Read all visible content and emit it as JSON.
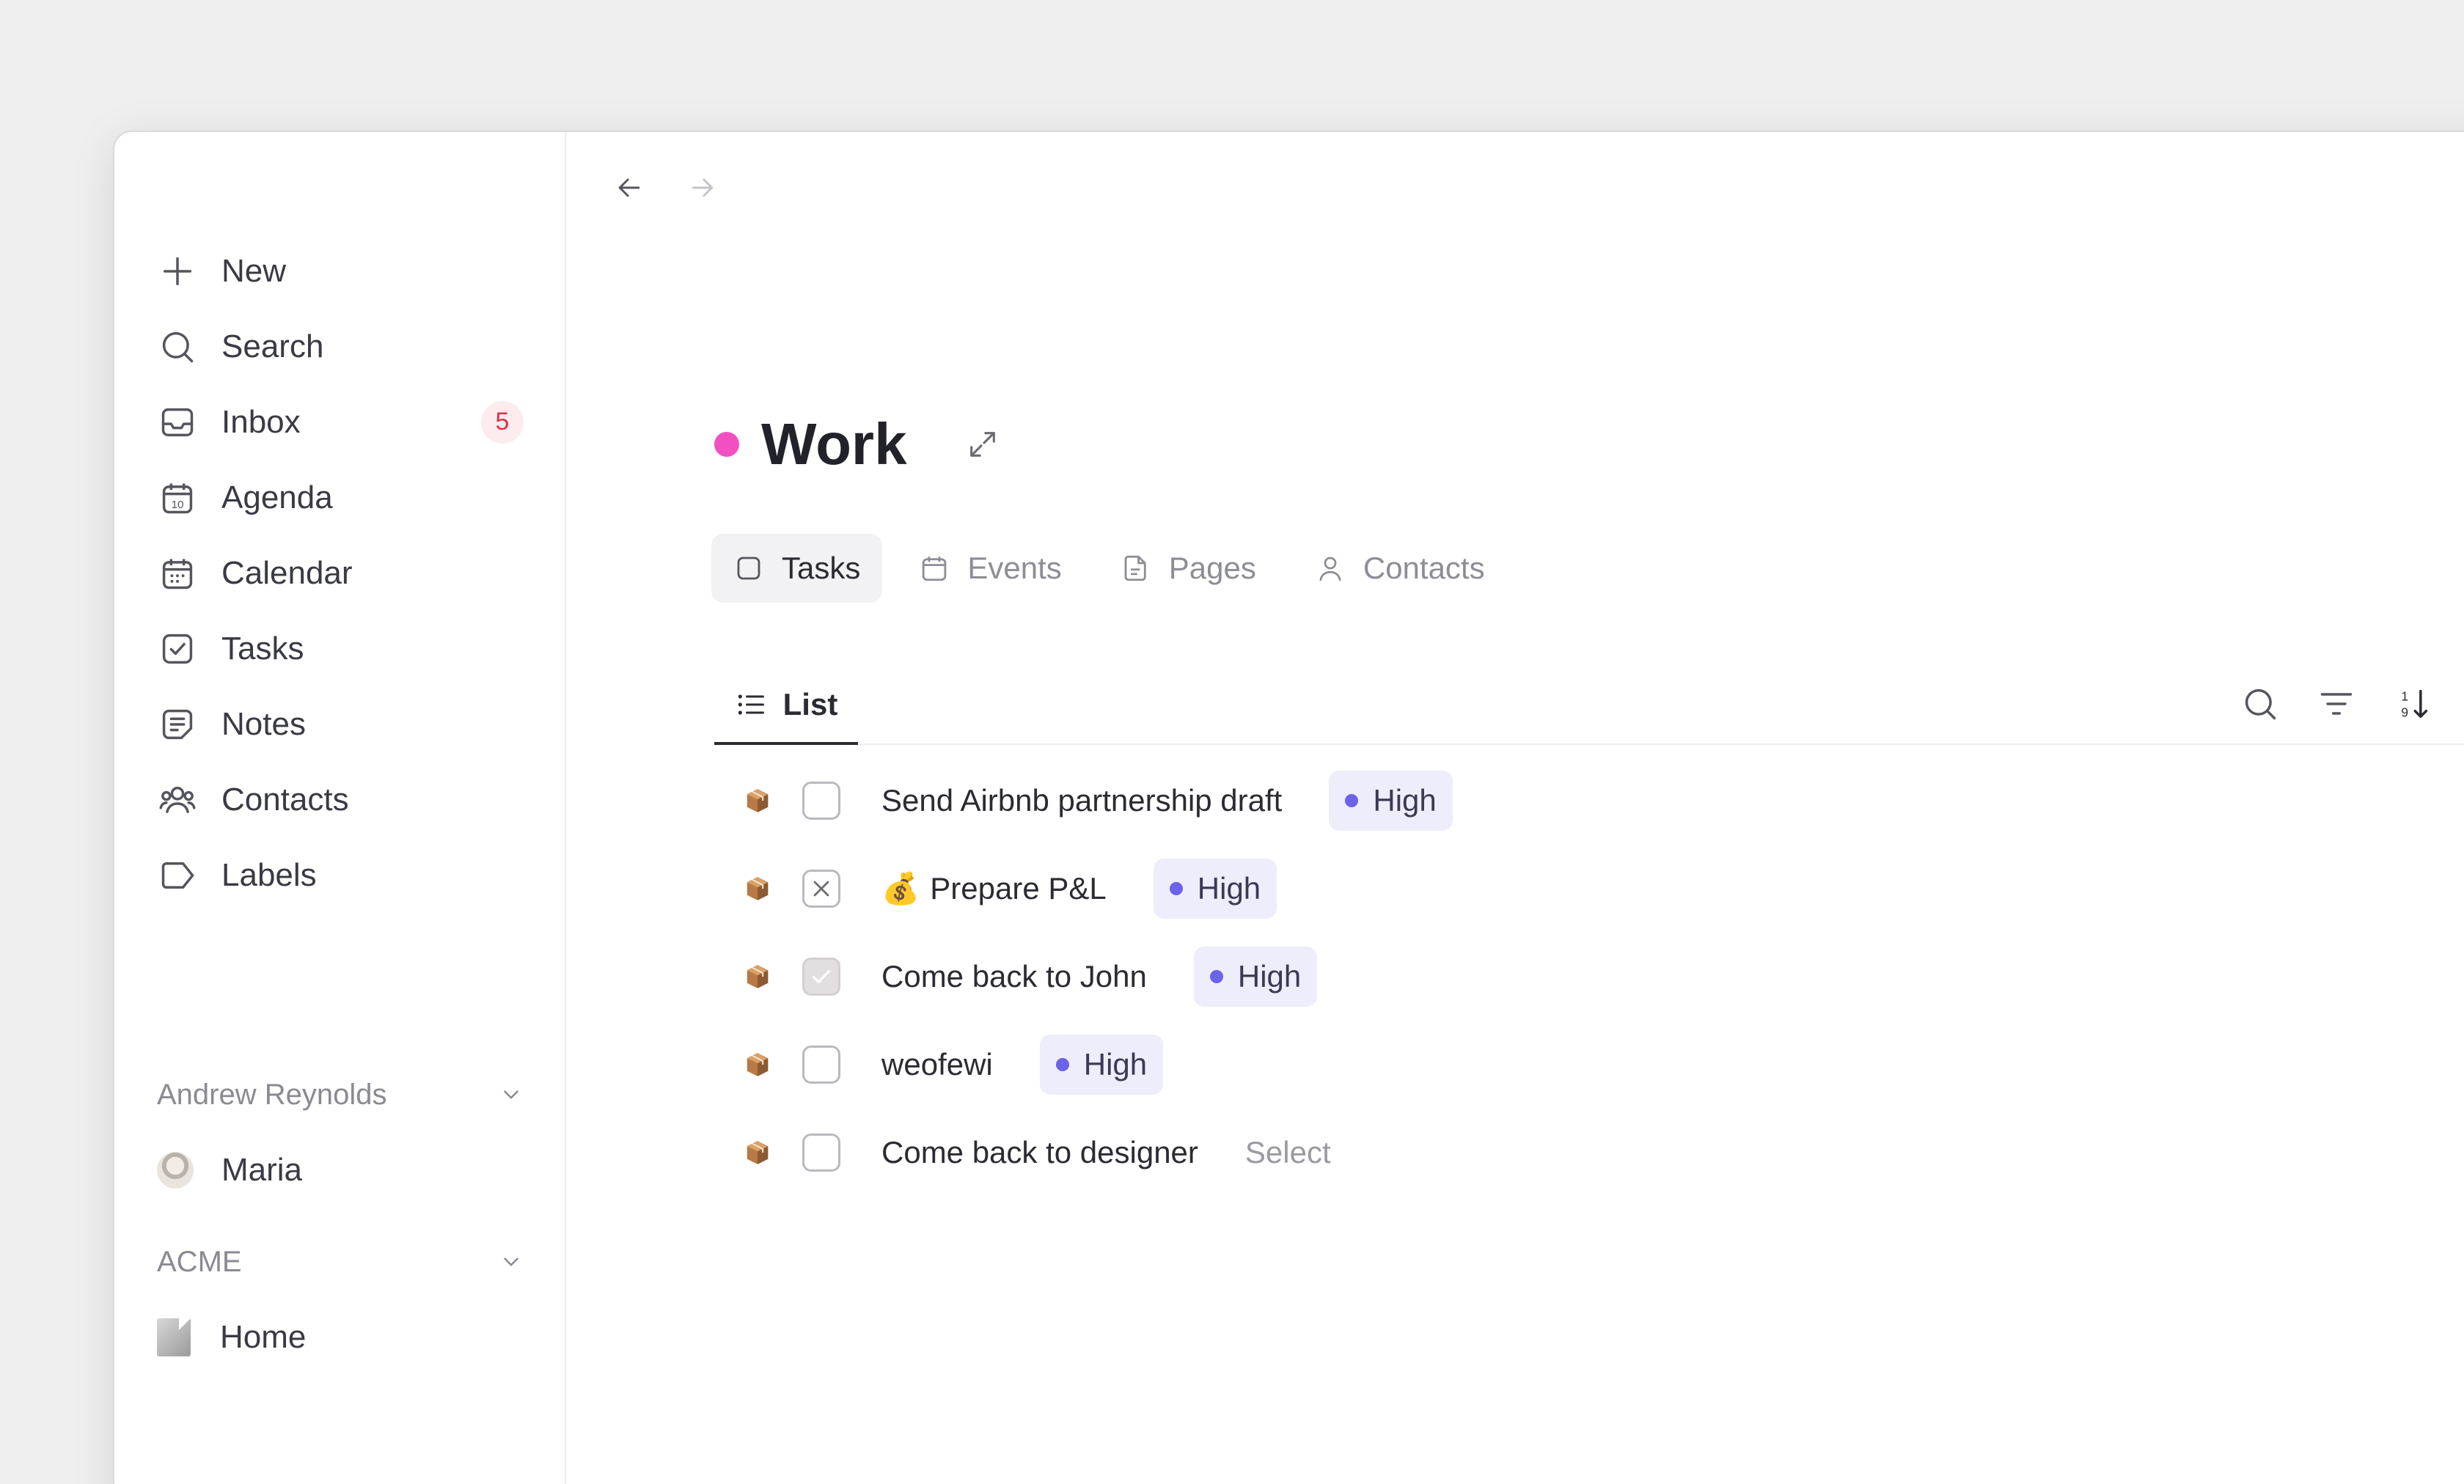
{
  "sidebar": {
    "items": [
      {
        "label": "New",
        "icon": "plus-icon"
      },
      {
        "label": "Search",
        "icon": "search-icon"
      },
      {
        "label": "Inbox",
        "icon": "inbox-icon",
        "badge": "5"
      },
      {
        "label": "Agenda",
        "icon": "agenda-icon"
      },
      {
        "label": "Calendar",
        "icon": "calendar-icon"
      },
      {
        "label": "Tasks",
        "icon": "checkbox-icon"
      },
      {
        "label": "Notes",
        "icon": "notes-icon"
      },
      {
        "label": "Contacts",
        "icon": "contacts-icon"
      },
      {
        "label": "Labels",
        "icon": "label-icon"
      }
    ],
    "sections": [
      {
        "title": "Andrew Reynolds",
        "items": [
          {
            "label": "Maria",
            "icon": "avatar"
          }
        ]
      },
      {
        "title": "ACME",
        "items": [
          {
            "label": "Home",
            "icon": "document-thumbnail"
          }
        ]
      }
    ],
    "agenda_icon_number": "10"
  },
  "main": {
    "title": "Work",
    "title_color": "#f24fc2",
    "tabs": [
      {
        "label": "Tasks",
        "icon": "checkbox-icon",
        "active": true
      },
      {
        "label": "Events",
        "icon": "calendar-icon",
        "active": false
      },
      {
        "label": "Pages",
        "icon": "page-icon",
        "active": false
      },
      {
        "label": "Contacts",
        "icon": "person-icon",
        "active": false
      }
    ],
    "view": {
      "label": "List",
      "icon": "list-icon"
    },
    "tasks": [
      {
        "title": "Send Airbnb partnership draft",
        "status": "open",
        "priority": "High"
      },
      {
        "emoji": "💰",
        "title": "Prepare P&L",
        "status": "cancelled",
        "priority": "High"
      },
      {
        "title": "Come back to John",
        "status": "done",
        "priority": "High"
      },
      {
        "title": "weofewi",
        "status": "open",
        "priority": "High"
      },
      {
        "title": "Come back to designer",
        "status": "open",
        "priority_placeholder": "Select"
      }
    ]
  },
  "colors": {
    "priority_dot": "#6b63e8",
    "priority_bg": "#eeedfb",
    "badge_text": "#e2334b"
  }
}
